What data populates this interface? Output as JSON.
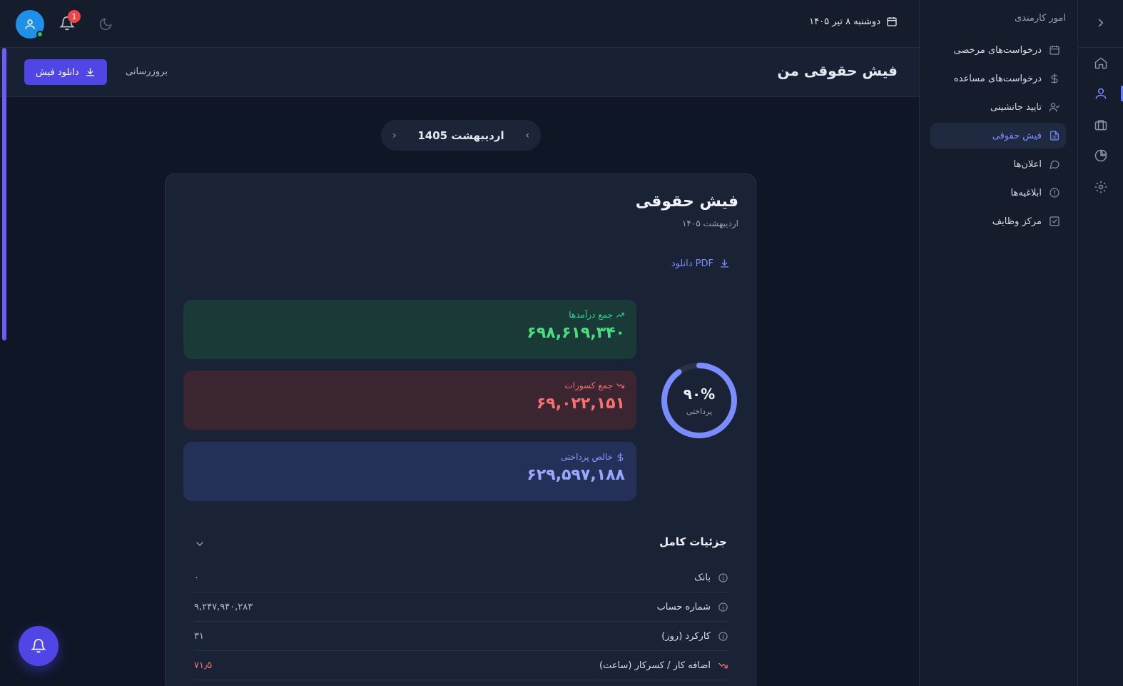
{
  "rail": {
    "icons": [
      "chevron-left-icon",
      "home-icon",
      "user-icon",
      "briefcase-icon",
      "chart-pie-icon",
      "gear-icon"
    ],
    "active_index": 2
  },
  "sidebar": {
    "section_title": "امور کارمندی",
    "items": [
      {
        "label": "درخواست‌های مرخصی",
        "icon": "calendar-icon"
      },
      {
        "label": "درخواست‌های مساعده",
        "icon": "dollar-icon"
      },
      {
        "label": "تایید جانشینی",
        "icon": "user-check-icon"
      },
      {
        "label": "فیش حقوقی",
        "icon": "file-text-icon",
        "active": true
      },
      {
        "label": "اعلان‌ها",
        "icon": "chat-icon"
      },
      {
        "label": "ابلاغیه‌ها",
        "icon": "alert-circle-icon"
      },
      {
        "label": "مرکز وظایف",
        "icon": "check-square-icon"
      }
    ]
  },
  "topbar": {
    "date": "دوشنبه ۸ تیر ۱۴۰۵",
    "notification_count": "1"
  },
  "page": {
    "title": "فیش حقوقی من",
    "refresh_label": "بروزرسانی",
    "download_label": "دانلود فیش"
  },
  "month_picker": {
    "label": "اردیبهشت 1405"
  },
  "card": {
    "title": "فیش حقوقی",
    "subtitle": "اردیبهشت ۱۴۰۵",
    "pdf_label": "دانلود PDF",
    "income": {
      "label": "جمع درآمدها",
      "value": "۶۹۸,۶۱۹,۳۴۰"
    },
    "deductions": {
      "label": "جمع کسورات",
      "value": "۶۹,۰۲۲,۱۵۱"
    },
    "net": {
      "label": "خالص پرداختی",
      "value": "۶۲۹,۵۹۷,۱۸۸"
    },
    "paid_percent_label": "۹۰%",
    "paid_fraction": 0.9,
    "paid_label": "پرداختی",
    "details_title": "جزئیات کامل",
    "details": [
      {
        "label": "بانک",
        "value": "۰"
      },
      {
        "label": "شماره حساب",
        "value": "۹,۲۴۷,۹۴۰,۲۸۳"
      },
      {
        "label": "کارکرد (روز)",
        "value": "۳۱"
      },
      {
        "label": "اضافه کار / کسرکار (ساعت)",
        "value": "۷۱٫۵"
      }
    ]
  },
  "colors": {
    "accent": "#4f46e5",
    "income": "#4ade80",
    "deduction": "#f87171",
    "net": "#9aa8ff",
    "ring": "#7b8cff"
  }
}
